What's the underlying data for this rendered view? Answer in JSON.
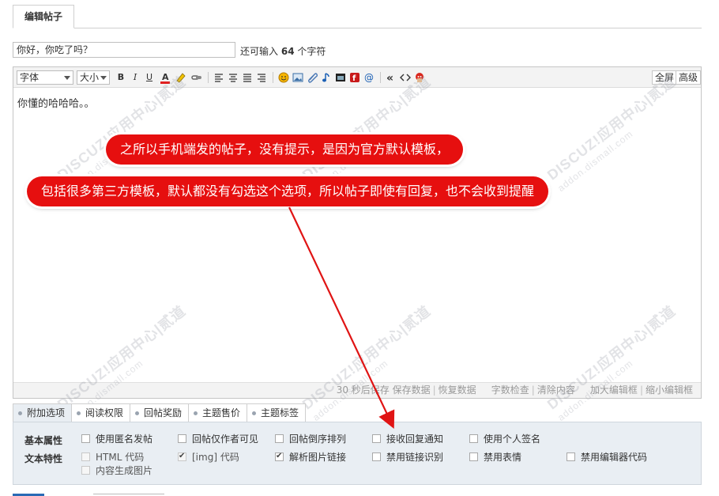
{
  "tab": {
    "label": "编辑帖子"
  },
  "subject": {
    "value": "你好，你吃了吗？"
  },
  "remain": {
    "prefix": "还可输入",
    "count": "64",
    "suffix": "个字符"
  },
  "toolbar": {
    "font_label": "字体",
    "size_label": "大小",
    "bold": "B",
    "italic": "I",
    "underline": "U",
    "fullscreen": "全屏",
    "advanced": "高级"
  },
  "editor": {
    "content": "你懂的哈哈哈。。"
  },
  "status": {
    "autosave": "30 秒后保存",
    "save": "保存数据",
    "restore": "恢复数据",
    "count": "字数检查",
    "clear": "清除内容",
    "enlarge": "加大编辑框",
    "shrink": "缩小编辑框"
  },
  "callouts": {
    "line1": "之所以手机端发的帖子，没有提示，是因为官方默认模板，",
    "line2": "包括很多第三方模板，默认都没有勾选这个选项，所以帖子即使有回复，也不会收到提醒"
  },
  "watermark": {
    "brand": "DISCUZ!应用中心|贰道",
    "site": "addon.dismall.com"
  },
  "option_tabs": [
    "附加选项",
    "阅读权限",
    "回帖奖励",
    "主题售价",
    "主题标签"
  ],
  "options": {
    "basic_label": "基本属性",
    "text_label": "文本特性",
    "basic": [
      {
        "label": "使用匿名发帖",
        "checked": false
      },
      {
        "label": "回帖仅作者可见",
        "checked": false
      },
      {
        "label": "回帖倒序排列",
        "checked": false
      },
      {
        "label": "接收回复通知",
        "checked": false
      },
      {
        "label": "使用个人签名",
        "checked": false
      }
    ],
    "text": [
      {
        "label": "HTML 代码",
        "checked": false,
        "disabled": true
      },
      {
        "label": "[img] 代码",
        "checked": true,
        "disabled": true
      },
      {
        "label": "解析图片链接",
        "checked": true
      },
      {
        "label": "禁用链接识别",
        "checked": false
      },
      {
        "label": "禁用表情",
        "checked": false
      },
      {
        "label": "禁用编辑器代码",
        "checked": false
      },
      {
        "label": "内容生成图片",
        "checked": false,
        "disabled": true
      }
    ]
  },
  "colors": {
    "callout": "#e60f0f",
    "arrow": "#e01414",
    "panel": "#e9eef3"
  }
}
